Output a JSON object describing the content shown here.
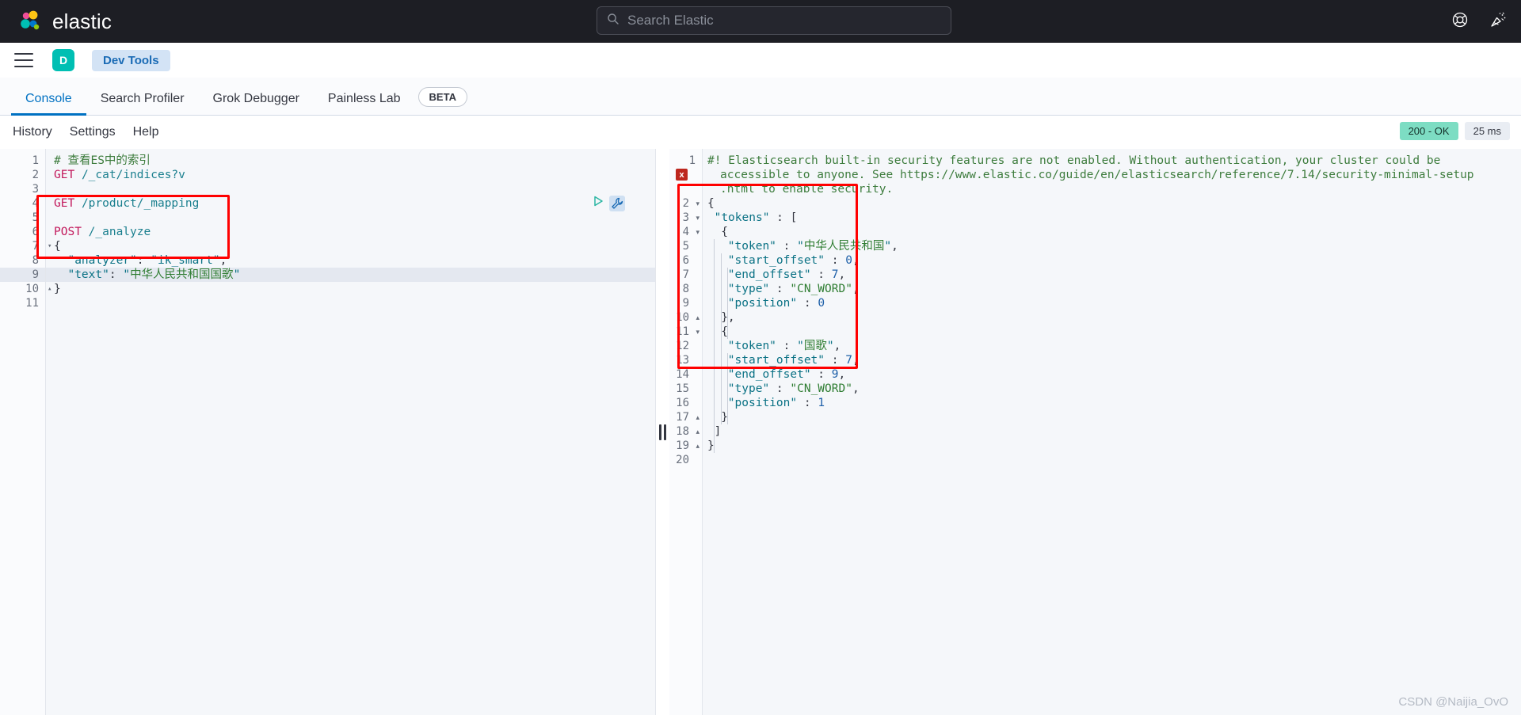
{
  "header": {
    "brand": "elastic",
    "logo_icon": "elastic-logo-icon",
    "search": {
      "placeholder": "Search Elastic",
      "icon": "search-icon"
    },
    "icons": [
      {
        "name": "help-lifebuoy-icon"
      },
      {
        "name": "party-popper-icon"
      }
    ]
  },
  "nav": {
    "menu_icon": "hamburger-menu-icon",
    "space_initial": "D",
    "breadcrumb": "Dev Tools"
  },
  "tabs": [
    {
      "label": "Console",
      "active": true
    },
    {
      "label": "Search Profiler",
      "active": false
    },
    {
      "label": "Grok Debugger",
      "active": false
    },
    {
      "label": "Painless Lab",
      "active": false
    }
  ],
  "beta_label": "BETA",
  "toolbar": {
    "links": [
      "History",
      "Settings",
      "Help"
    ],
    "status_code": "200 - OK",
    "elapsed": "25 ms"
  },
  "editor": {
    "lines": [
      {
        "n": 1,
        "tokens": [
          {
            "t": "comment",
            "v": "# 查看ES中的索引"
          }
        ]
      },
      {
        "n": 2,
        "tokens": [
          {
            "t": "method",
            "v": "GET"
          },
          {
            "t": "plain",
            "v": " "
          },
          {
            "t": "url",
            "v": "/_cat/indices?v"
          }
        ]
      },
      {
        "n": 3,
        "tokens": []
      },
      {
        "n": 4,
        "tokens": [
          {
            "t": "method",
            "v": "GET"
          },
          {
            "t": "plain",
            "v": " "
          },
          {
            "t": "url",
            "v": "/product/_mapping"
          }
        ]
      },
      {
        "n": 5,
        "tokens": []
      },
      {
        "n": 6,
        "tokens": [
          {
            "t": "method",
            "v": "POST"
          },
          {
            "t": "plain",
            "v": " "
          },
          {
            "t": "url",
            "v": "/_analyze"
          }
        ]
      },
      {
        "n": 7,
        "fold": "down",
        "tokens": [
          {
            "t": "punct",
            "v": "{"
          }
        ]
      },
      {
        "n": 8,
        "tokens": [
          {
            "t": "plain",
            "v": "  "
          },
          {
            "t": "key",
            "v": "\"analyzer\""
          },
          {
            "t": "punct",
            "v": ": "
          },
          {
            "t": "string",
            "v": "\"ik_smart\""
          },
          {
            "t": "punct",
            "v": ","
          }
        ]
      },
      {
        "n": 9,
        "highlight": true,
        "tokens": [
          {
            "t": "plain",
            "v": "  "
          },
          {
            "t": "key",
            "v": "\"text\""
          },
          {
            "t": "punct",
            "v": ": "
          },
          {
            "t": "string",
            "v": "\""
          },
          {
            "t": "cn",
            "v": "中华人民共和国国歌"
          },
          {
            "t": "string",
            "v": "\""
          }
        ]
      },
      {
        "n": 10,
        "fold": "up",
        "tokens": [
          {
            "t": "punct",
            "v": "}"
          }
        ]
      },
      {
        "n": 11,
        "tokens": []
      }
    ],
    "run_icon": "play-run-icon",
    "wrench_icon": "wrench-tools-icon"
  },
  "output": {
    "warning_lines": [
      "#! Elasticsearch built-in security features are not enabled. Without authentication, your cluster could be",
      "accessible to anyone. See https://www.elastic.co/guide/en/elasticsearch/reference/7.14/security-minimal-setup",
      ".html to enable security."
    ],
    "error_marker": "x",
    "lines": [
      {
        "n": 2,
        "fold": "down",
        "indent": 0,
        "tokens": [
          {
            "t": "punct",
            "v": "{"
          }
        ]
      },
      {
        "n": 3,
        "fold": "down",
        "indent": 1,
        "tokens": [
          {
            "t": "key",
            "v": "\"tokens\""
          },
          {
            "t": "punct",
            "v": " : ["
          }
        ]
      },
      {
        "n": 4,
        "fold": "down",
        "indent": 2,
        "tokens": [
          {
            "t": "punct",
            "v": "{"
          }
        ]
      },
      {
        "n": 5,
        "indent": 3,
        "tokens": [
          {
            "t": "key",
            "v": "\"token\""
          },
          {
            "t": "punct",
            "v": " : "
          },
          {
            "t": "string",
            "v": "\""
          },
          {
            "t": "cn",
            "v": "中华人民共和国"
          },
          {
            "t": "string",
            "v": "\""
          },
          {
            "t": "punct",
            "v": ","
          }
        ]
      },
      {
        "n": 6,
        "indent": 3,
        "tokens": [
          {
            "t": "key",
            "v": "\"start_offset\""
          },
          {
            "t": "punct",
            "v": " : "
          },
          {
            "t": "num",
            "v": "0"
          },
          {
            "t": "punct",
            "v": ","
          }
        ]
      },
      {
        "n": 7,
        "indent": 3,
        "tokens": [
          {
            "t": "key",
            "v": "\"end_offset\""
          },
          {
            "t": "punct",
            "v": " : "
          },
          {
            "t": "num",
            "v": "7"
          },
          {
            "t": "punct",
            "v": ","
          }
        ]
      },
      {
        "n": 8,
        "indent": 3,
        "tokens": [
          {
            "t": "key",
            "v": "\"type\""
          },
          {
            "t": "punct",
            "v": " : "
          },
          {
            "t": "cn",
            "v": "\"CN_WORD\""
          },
          {
            "t": "punct",
            "v": ","
          }
        ]
      },
      {
        "n": 9,
        "indent": 3,
        "tokens": [
          {
            "t": "key",
            "v": "\"position\""
          },
          {
            "t": "punct",
            "v": " : "
          },
          {
            "t": "num",
            "v": "0"
          }
        ]
      },
      {
        "n": 10,
        "fold": "up",
        "indent": 2,
        "tokens": [
          {
            "t": "punct",
            "v": "},"
          }
        ]
      },
      {
        "n": 11,
        "fold": "down",
        "indent": 2,
        "tokens": [
          {
            "t": "punct",
            "v": "{"
          }
        ]
      },
      {
        "n": 12,
        "indent": 3,
        "tokens": [
          {
            "t": "key",
            "v": "\"token\""
          },
          {
            "t": "punct",
            "v": " : "
          },
          {
            "t": "string",
            "v": "\""
          },
          {
            "t": "cn",
            "v": "国歌"
          },
          {
            "t": "string",
            "v": "\""
          },
          {
            "t": "punct",
            "v": ","
          }
        ]
      },
      {
        "n": 13,
        "indent": 3,
        "tokens": [
          {
            "t": "key",
            "v": "\"start_offset\""
          },
          {
            "t": "punct",
            "v": " : "
          },
          {
            "t": "num",
            "v": "7"
          },
          {
            "t": "punct",
            "v": ","
          }
        ]
      },
      {
        "n": 14,
        "indent": 3,
        "tokens": [
          {
            "t": "key",
            "v": "\"end_offset\""
          },
          {
            "t": "punct",
            "v": " : "
          },
          {
            "t": "num",
            "v": "9"
          },
          {
            "t": "punct",
            "v": ","
          }
        ]
      },
      {
        "n": 15,
        "indent": 3,
        "tokens": [
          {
            "t": "key",
            "v": "\"type\""
          },
          {
            "t": "punct",
            "v": " : "
          },
          {
            "t": "cn",
            "v": "\"CN_WORD\""
          },
          {
            "t": "punct",
            "v": ","
          }
        ]
      },
      {
        "n": 16,
        "indent": 3,
        "tokens": [
          {
            "t": "key",
            "v": "\"position\""
          },
          {
            "t": "punct",
            "v": " : "
          },
          {
            "t": "num",
            "v": "1"
          }
        ]
      },
      {
        "n": 17,
        "fold": "up",
        "indent": 2,
        "tokens": [
          {
            "t": "punct",
            "v": "}"
          }
        ]
      },
      {
        "n": 18,
        "fold": "up",
        "indent": 1,
        "tokens": [
          {
            "t": "punct",
            "v": "]"
          }
        ]
      },
      {
        "n": 19,
        "fold": "up",
        "indent": 0,
        "tokens": [
          {
            "t": "punct",
            "v": "}"
          }
        ]
      },
      {
        "n": 20,
        "indent": 0,
        "tokens": []
      }
    ]
  },
  "watermark": "CSDN @Naijia_OvO",
  "colors": {
    "header_bg": "#1d1e24",
    "accent": "#0071c2",
    "space_badge": "#00bfb3",
    "status_ok": "#7dddc3",
    "annotation": "#ff0000",
    "comment": "#3d7c3d",
    "method": "#c2185b",
    "string": "#0b7285"
  }
}
